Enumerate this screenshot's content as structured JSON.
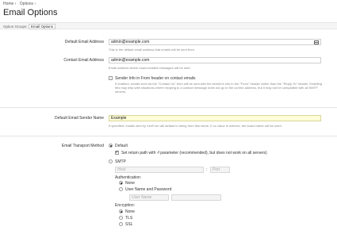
{
  "breadcrumb": [
    "Home ›",
    "Options ›"
  ],
  "page_title": "Email Options",
  "option_groups": {
    "label": "Option Groups:",
    "selected": "Email Options"
  },
  "default_email": {
    "label": "Default Email Address",
    "value": "admin@example.com",
    "hint": "This is the default email address that emails will be sent from."
  },
  "contact_email": {
    "label": "Contact Email Address",
    "value": "admin@example.com",
    "hint": "Email address where board-related messages will be sent."
  },
  "sender_info": {
    "label": "Sender Info in From header on contact emails",
    "hint": "If enabled, emails sent via the \"Contact Us\" form will be sent with the sender's info in the \"From\" header rather than the \"Reply-To\" header. Enabling this may help with situations where replying to a contact message does not go to the correct address, but it may not be compatible with all SMTP servers."
  },
  "sender_name": {
    "label": "Default Email Sender Name",
    "value": "Example",
    "hint": "If specified, emails sent by XenForo will default to being from this name. If no value is entered, the board name will be used."
  },
  "transport": {
    "label": "Email Transport Method",
    "default_label": "Default",
    "return_path_label": "Set return path with -f parameter (recommended), but does not work on all servers)",
    "smtp_label": "SMTP",
    "host_placeholder": "Host",
    "port_placeholder": "Port",
    "colon": ":",
    "auth_title": "Authentication:",
    "auth_none": "None",
    "auth_userpass": "User Name and Password",
    "username_placeholder": "User Name",
    "enc_title": "Encryption:",
    "enc_none": "None",
    "enc_tls": "TLS",
    "enc_ssl": "SSL"
  }
}
